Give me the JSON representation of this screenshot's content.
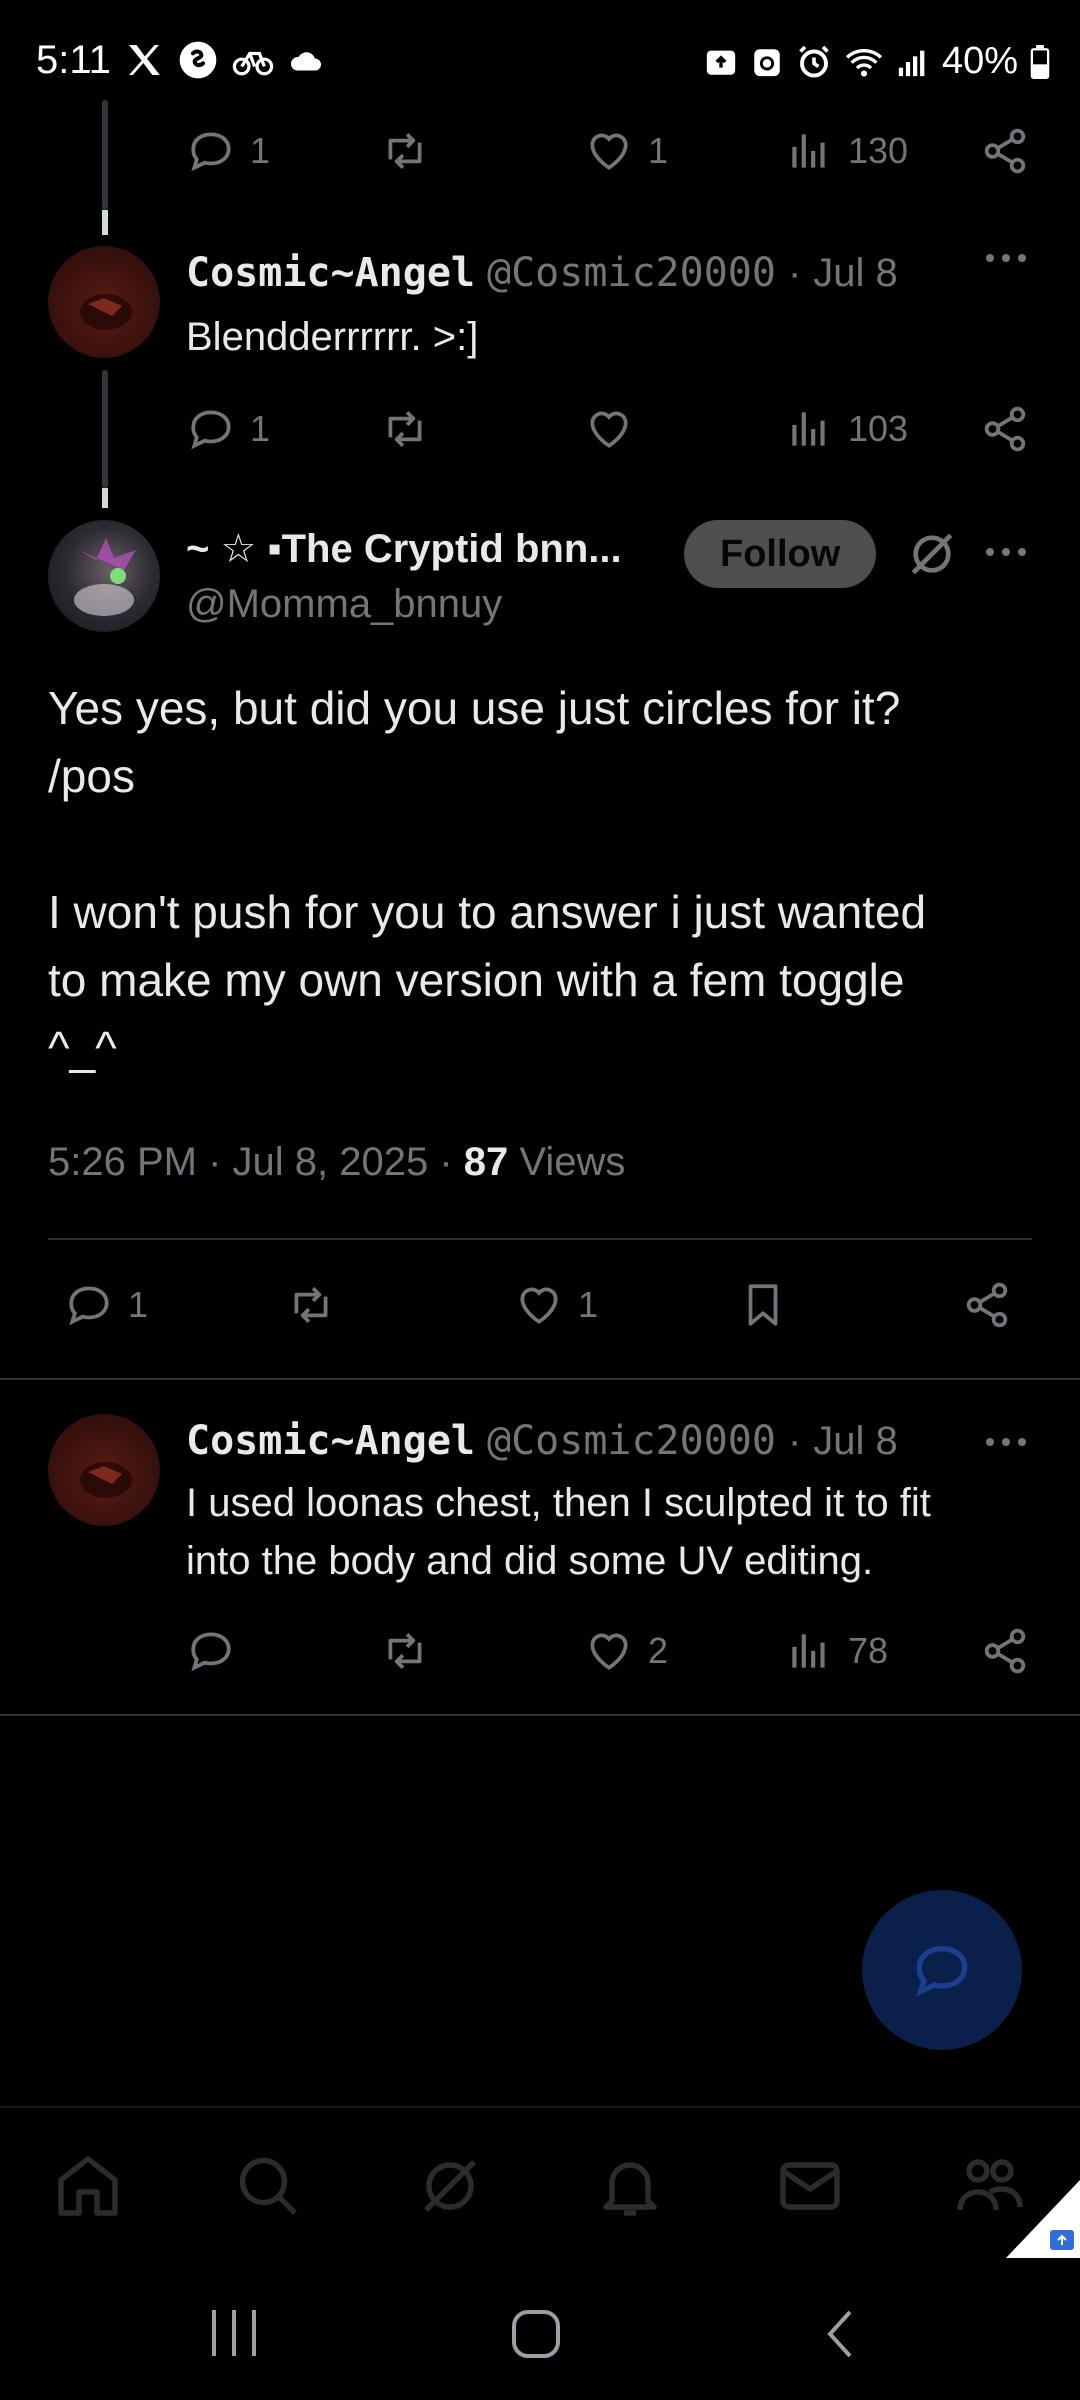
{
  "status_bar": {
    "time": "5:11",
    "battery": "40%"
  },
  "top_tweet_actions": {
    "replies": "1",
    "likes": "1",
    "views": "130"
  },
  "reply1": {
    "name": "Cosmic~Angel",
    "handle": "@Cosmic20000",
    "date": "Jul 8",
    "text": "Blendderrrrrr. >:]",
    "replies": "1",
    "views": "103"
  },
  "main_tweet": {
    "name": "~ ☆ ▪The Cryptid bnn...",
    "handle": "@Momma_bnnuy",
    "follow_label": "Follow",
    "text": "Yes yes, but did you use just circles for it?\n/pos\n\nI won't push for you to answer i just wanted\nto make my own version with a fem toggle\n^_^",
    "time": "5:26 PM",
    "date": "Jul 8, 2025",
    "views_count": "87",
    "views_label": "Views",
    "replies": "1",
    "likes": "1"
  },
  "reply2": {
    "name": "Cosmic~Angel",
    "handle": "@Cosmic20000",
    "date": "Jul 8",
    "text": "I used loonas chest, then I sculpted it to fit\ninto the body and did some UV editing.",
    "likes": "2",
    "views": "78"
  },
  "colors": {
    "background": "#000000",
    "text": "#e7e9ea",
    "muted": "#71767b",
    "divider": "#2f3336",
    "fab": "#0a1f4a"
  },
  "icons": [
    "x-logo-icon",
    "shazam-icon",
    "cloud-icon",
    "reply-icon",
    "retweet-icon",
    "like-icon",
    "views-icon",
    "share-icon",
    "bookmark-icon",
    "grok-icon",
    "home-icon",
    "search-icon",
    "bell-icon",
    "mail-icon",
    "communities-icon"
  ]
}
